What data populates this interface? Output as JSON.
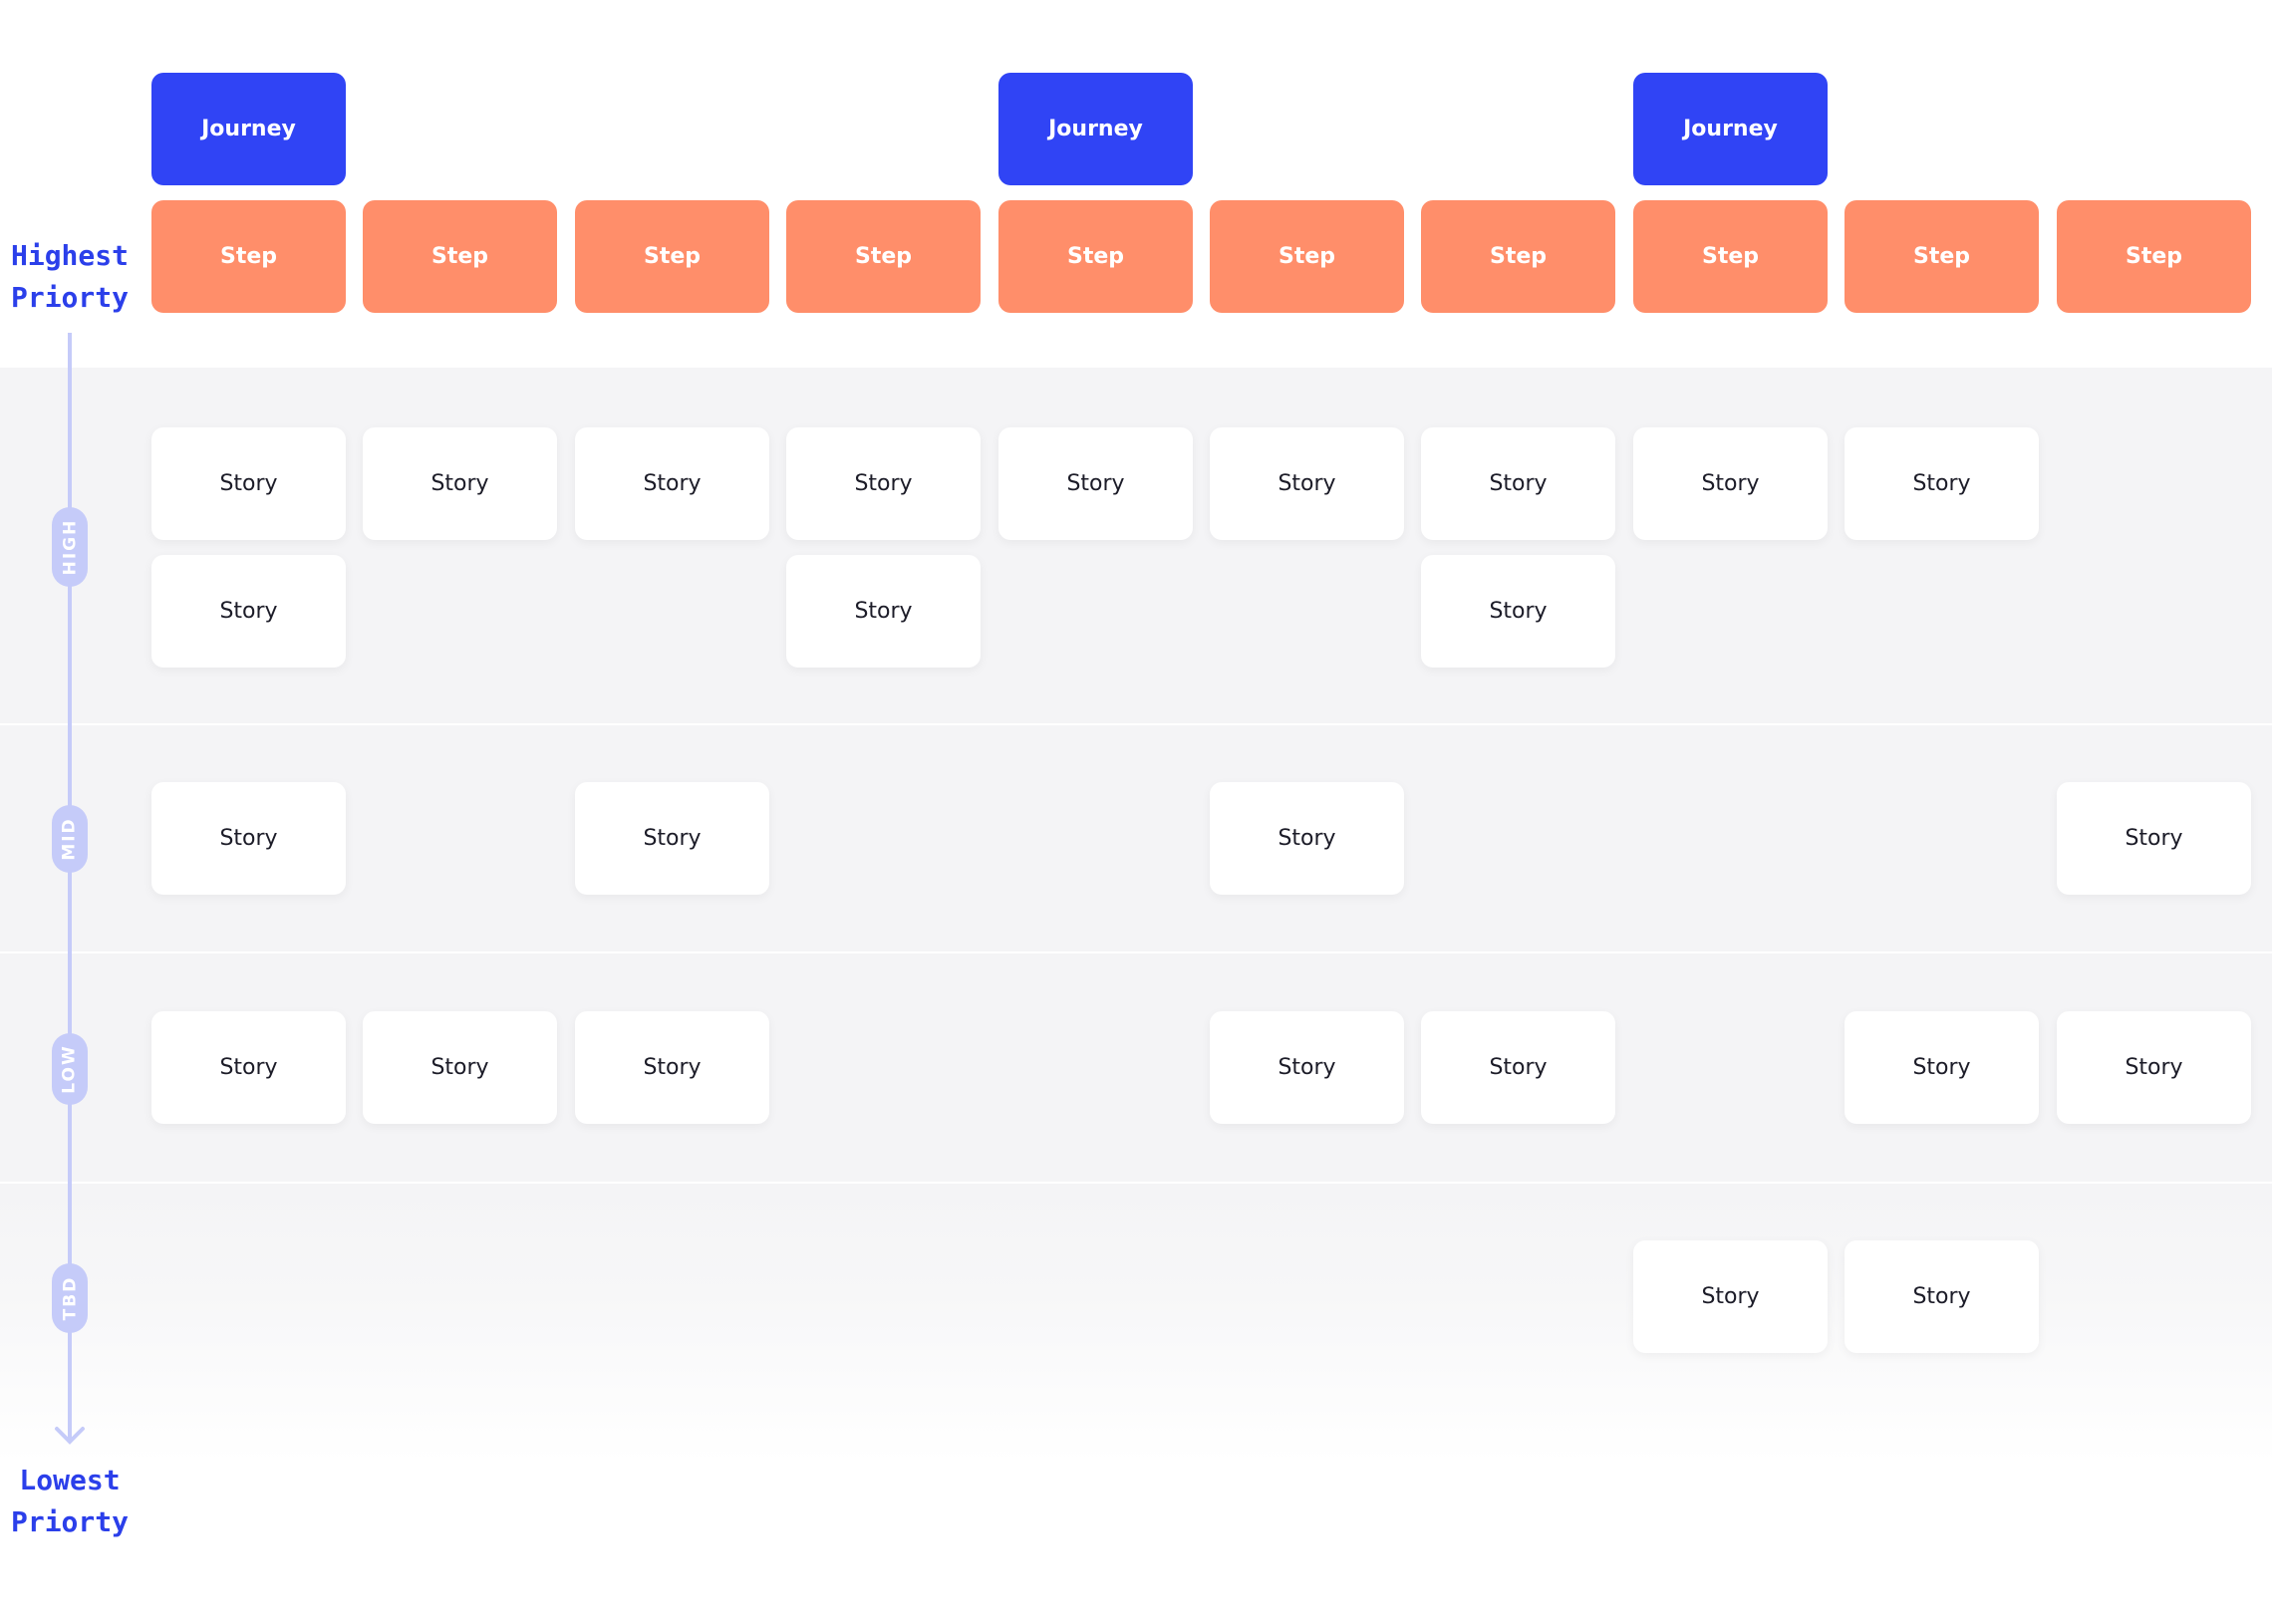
{
  "axis": {
    "top_label": [
      "Highest",
      "Priorty"
    ],
    "bottom_label": [
      "Lowest",
      "Priorty"
    ],
    "color": "#c5cbf9",
    "label_color": "#2b3fea"
  },
  "colors": {
    "journey": "#3044f5",
    "step": "#ff8e6a",
    "story": "#ffffff",
    "band": "#f4f4f6"
  },
  "journeys": [
    {
      "label": "Journey",
      "column": 0
    },
    {
      "label": "Journey",
      "column": 4
    },
    {
      "label": "Journey",
      "column": 7
    }
  ],
  "steps": [
    "Step",
    "Step",
    "Step",
    "Step",
    "Step",
    "Step",
    "Step",
    "Step",
    "Step",
    "Step"
  ],
  "priorities": [
    {
      "label": "HIGH",
      "rows": [
        {
          "story_label": "Story",
          "columns": [
            0,
            1,
            2,
            3,
            4,
            5,
            6,
            7,
            8
          ]
        },
        {
          "story_label": "Story",
          "columns": [
            0,
            3,
            6
          ]
        }
      ]
    },
    {
      "label": "MID",
      "rows": [
        {
          "story_label": "Story",
          "columns": [
            0,
            2,
            5,
            9
          ]
        }
      ]
    },
    {
      "label": "LOW",
      "rows": [
        {
          "story_label": "Story",
          "columns": [
            0,
            1,
            2,
            5,
            6,
            8,
            9
          ]
        }
      ]
    },
    {
      "label": "TBD",
      "rows": [
        {
          "story_label": "Story",
          "columns": [
            7,
            8
          ]
        }
      ]
    }
  ]
}
